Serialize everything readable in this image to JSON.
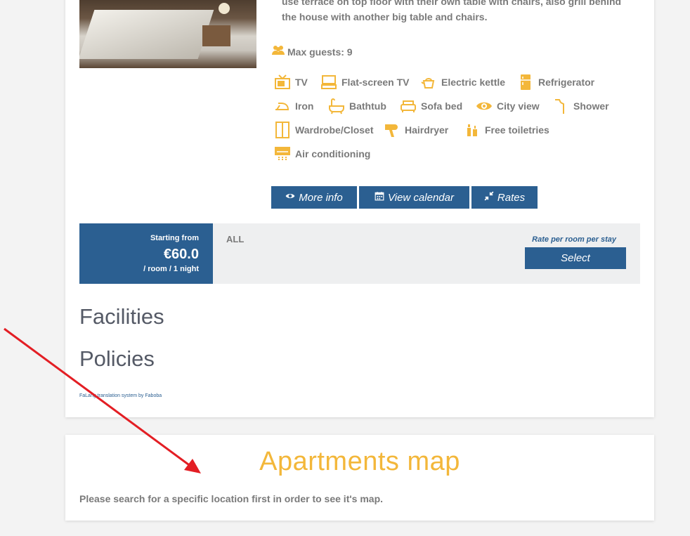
{
  "room": {
    "description": "use terrace on top floor with their own table with chairs, also grill behind the house with another big table and chairs.",
    "max_guests": "Max guests: 9",
    "amenities": [
      {
        "label": "TV",
        "icon": "tv-icon"
      },
      {
        "label": "Flat-screen TV",
        "icon": "flat-screen-tv-icon"
      },
      {
        "label": "Electric kettle",
        "icon": "kettle-icon"
      },
      {
        "label": "Refrigerator",
        "icon": "refrigerator-icon"
      },
      {
        "label": "Iron",
        "icon": "iron-icon"
      },
      {
        "label": "Bathtub",
        "icon": "bathtub-icon"
      },
      {
        "label": "Sofa bed",
        "icon": "sofa-bed-icon"
      },
      {
        "label": "City view",
        "icon": "eye-icon"
      },
      {
        "label": "Shower",
        "icon": "shower-icon"
      },
      {
        "label": "Wardrobe/Closet",
        "icon": "wardrobe-icon"
      },
      {
        "label": "Hairdryer",
        "icon": "hairdryer-icon"
      },
      {
        "label": "Free toiletries",
        "icon": "toiletries-icon"
      },
      {
        "label": "Air conditioning",
        "icon": "air-conditioning-icon"
      }
    ],
    "buttons": {
      "more_info": "More info",
      "view_calendar": "View calendar",
      "rates": "Rates"
    }
  },
  "rate": {
    "starting_from": "Starting from",
    "price": "€60.0",
    "per": "/ room / 1 night",
    "name": "ALL",
    "rate_label": "Rate per room per stay",
    "select": "Select"
  },
  "sections": {
    "facilities": "Facilities",
    "policies": "Policies",
    "falang": "FaLang translation system by Faboba"
  },
  "map": {
    "title": "Apartments map",
    "note": "Please search for a specific location first in order to see it's map."
  },
  "colors": {
    "accent": "#f3b73a",
    "primary": "#2b5f91",
    "arrow": "#e31e24"
  }
}
